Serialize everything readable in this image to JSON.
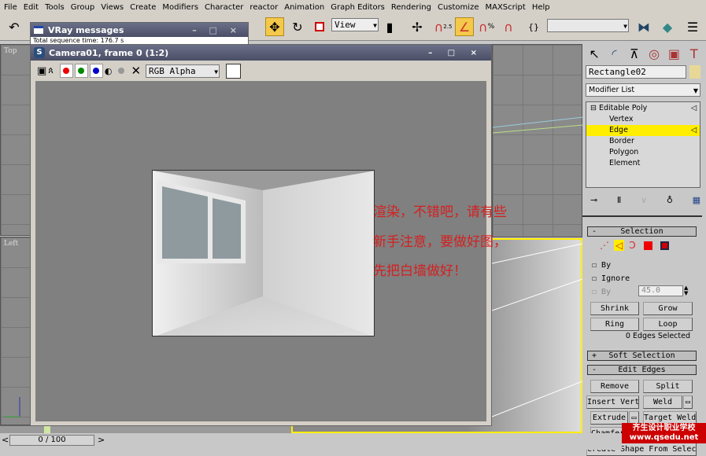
{
  "menu": [
    "File",
    "Edit",
    "Tools",
    "Group",
    "Views",
    "Create",
    "Modifiers",
    "Character",
    "reactor",
    "Animation",
    "Graph Editors",
    "Rendering",
    "Customize",
    "MAXScript",
    "Help"
  ],
  "toolbar": {
    "ref_coord": "View",
    "named_selection": "",
    "snap_value": "2.5",
    "percent_symbol": "%"
  },
  "viewports": {
    "top": "Top",
    "left": "Left"
  },
  "vray_window": {
    "title": "VRay messages",
    "line": "Total sequence time: 176.7 s"
  },
  "camera_window": {
    "title": "Camera01, frame 0 (1:2)",
    "channel": "RGB Alpha"
  },
  "annotation": [
    "渲染，不错吧，请有些",
    "新手注意，要做好图，",
    "先把白墙做好！"
  ],
  "command_panel": {
    "object_name": "Rectangle02",
    "object_color": "#e8d898",
    "modifier_list": "Modifier List",
    "stack": [
      "Editable Poly",
      "Vertex",
      "Edge",
      "Border",
      "Polygon",
      "Element"
    ],
    "selected_stack": "Edge",
    "selection": {
      "title": "Selection",
      "by_vertex": "By",
      "ignore": "Ignore",
      "by_angle": "By",
      "angle": "45.0",
      "shrink": "Shrink",
      "grow": "Grow",
      "ring": "Ring",
      "loop": "Loop",
      "status": "0 Edges Selected"
    },
    "soft_selection": "Soft Selection",
    "edit_edges": {
      "title": "Edit Edges",
      "remove": "Remove",
      "split": "Split",
      "insert_vertex": "Insert Vertex",
      "weld": "Weld",
      "extrude": "Extrude",
      "target_weld": "Target Weld",
      "chamfer": "Chamfer",
      "create_shape": "Create Shape From Selection"
    }
  },
  "timeline": {
    "frame": "0 / 100"
  },
  "watermark": [
    "齐生设计职业学校",
    "www.qsedu.net"
  ],
  "colors": {
    "highlight": "#ffee00",
    "active_tool": "#f4c84a"
  }
}
